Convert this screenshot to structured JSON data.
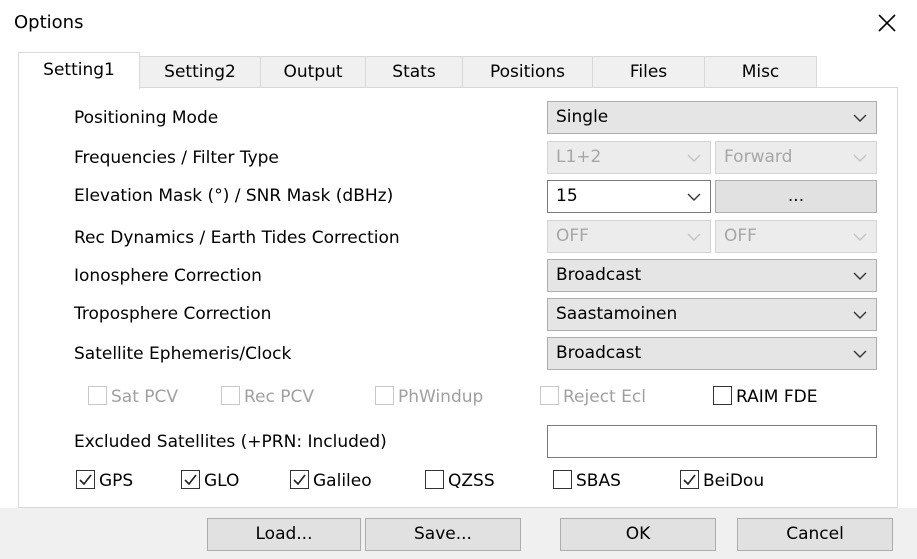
{
  "window": {
    "title": "Options",
    "close_icon": "close-icon"
  },
  "tabs": [
    {
      "label": "Setting1"
    },
    {
      "label": "Setting2"
    },
    {
      "label": "Output"
    },
    {
      "label": "Stats"
    },
    {
      "label": "Positions"
    },
    {
      "label": "Files"
    },
    {
      "label": "Misc"
    }
  ],
  "settings": {
    "positioning_mode": {
      "label": "Positioning Mode",
      "value": "Single"
    },
    "frequencies": {
      "label": "Frequencies / Filter Type",
      "freq_value": "L1+2",
      "filter_value": "Forward"
    },
    "elevation": {
      "label": "Elevation Mask (°) / SNR Mask (dBHz)",
      "elev_value": "15",
      "snr_button": "..."
    },
    "rec_dynamics": {
      "label": "Rec Dynamics / Earth Tides Correction",
      "dyn_value": "OFF",
      "tides_value": "OFF"
    },
    "ionosphere": {
      "label": "Ionosphere Correction",
      "value": "Broadcast"
    },
    "troposphere": {
      "label": "Troposphere Correction",
      "value": "Saastamoinen"
    },
    "ephemeris": {
      "label": "Satellite Ephemeris/Clock",
      "value": "Broadcast"
    }
  },
  "options_checks": {
    "sat_pcv": {
      "label": "Sat PCV",
      "checked": false,
      "enabled": false
    },
    "rec_pcv": {
      "label": "Rec PCV",
      "checked": false,
      "enabled": false
    },
    "phwindup": {
      "label": "PhWindup",
      "checked": false,
      "enabled": false
    },
    "reject_ecl": {
      "label": "Reject Ecl",
      "checked": false,
      "enabled": false
    },
    "raim_fde": {
      "label": "RAIM FDE",
      "checked": false,
      "enabled": true
    }
  },
  "excluded": {
    "label": "Excluded Satellites (+PRN: Included)",
    "value": ""
  },
  "systems": {
    "gps": {
      "label": "GPS",
      "checked": true
    },
    "glo": {
      "label": "GLO",
      "checked": true
    },
    "galileo": {
      "label": "Galileo",
      "checked": true
    },
    "qzss": {
      "label": "QZSS",
      "checked": false
    },
    "sbas": {
      "label": "SBAS",
      "checked": false
    },
    "beidou": {
      "label": "BeiDou",
      "checked": true
    }
  },
  "footer": {
    "load": "Load...",
    "save": "Save...",
    "ok": "OK",
    "cancel": "Cancel"
  }
}
